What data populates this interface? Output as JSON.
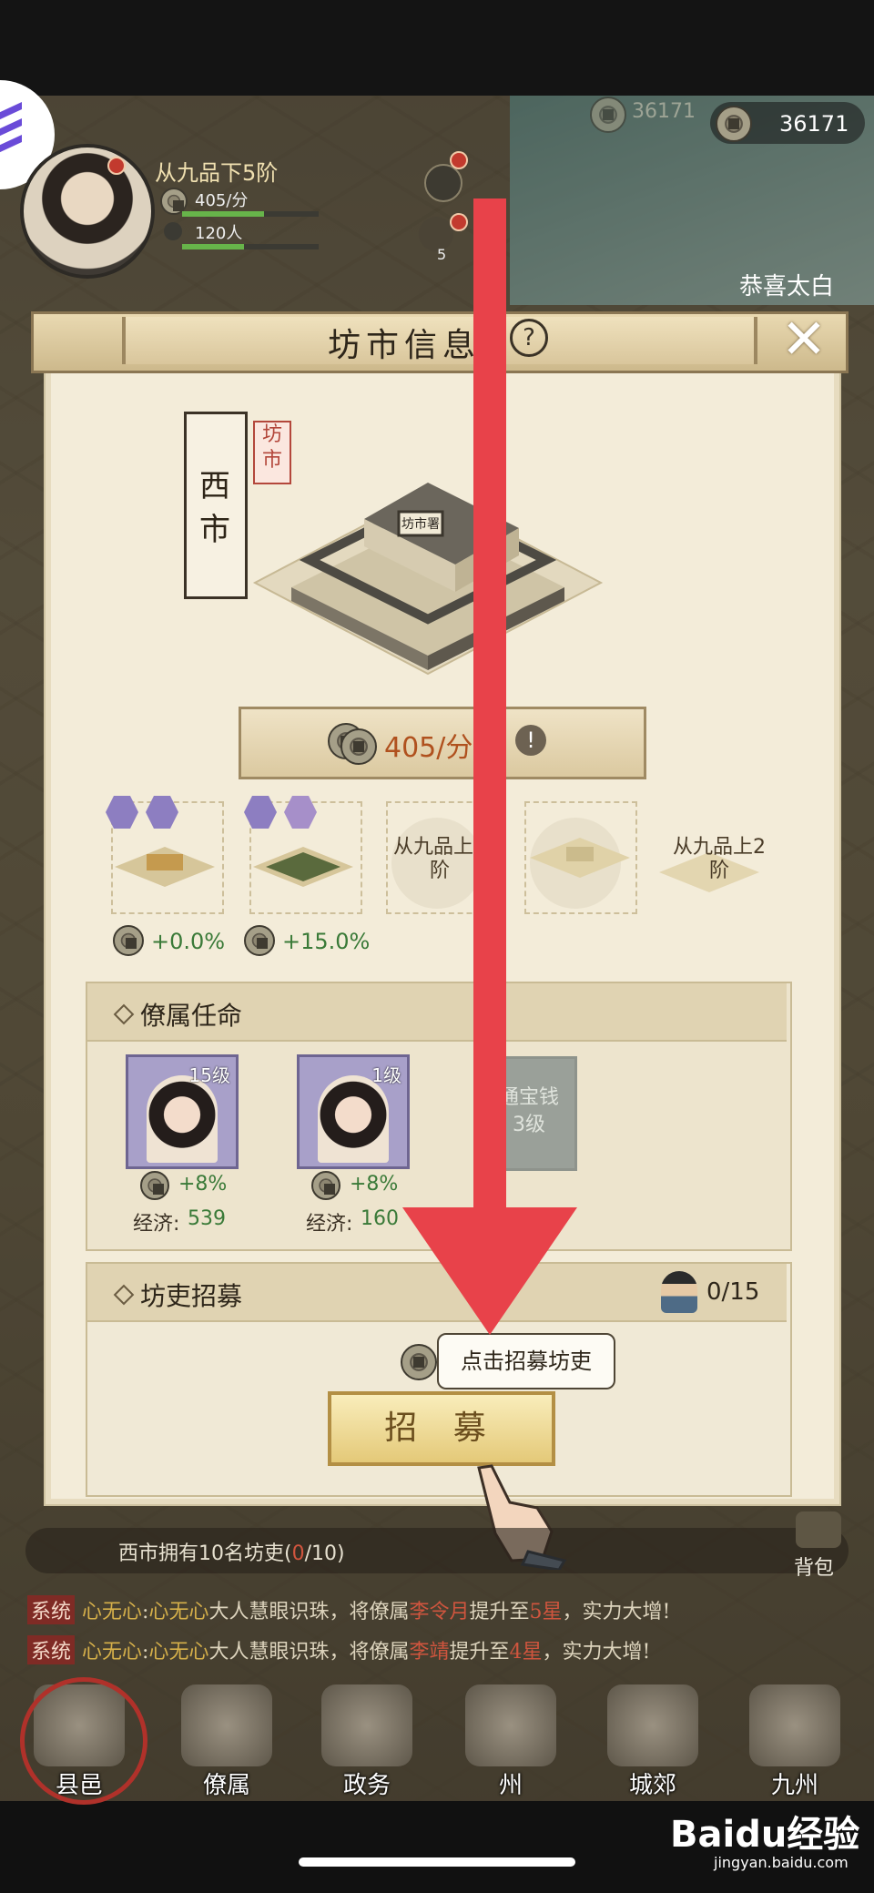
{
  "currency": {
    "ghost_value": "36171",
    "value": "36171"
  },
  "player": {
    "rank": "从九品下5阶",
    "income": "405/分",
    "population": "120人",
    "badge_count": "5"
  },
  "marquee": "恭喜太白",
  "modal": {
    "title": "坊市信息",
    "help": "?",
    "close": "✕",
    "market_name": "西市",
    "building_tag": "坊市",
    "building_plaque": "坊市署",
    "rate": "405/分钟",
    "rate_info": "!",
    "upgrades": [
      {
        "bonus": "+0.0%"
      },
      {
        "bonus": "+15.0%"
      },
      {
        "label": "从九品上2阶"
      },
      {
        "label": ""
      },
      {
        "label": "从九品上2阶"
      }
    ],
    "appointments": {
      "title": "僚属任命",
      "cards": [
        {
          "level": "15级",
          "bonus": "+8%",
          "economy_label": "经济:",
          "economy_value": "539"
        },
        {
          "level": "1级",
          "bonus": "+8%",
          "economy_label": "经济:",
          "economy_value": "160"
        }
      ],
      "locked_card": "通宝钱3级"
    },
    "recruit": {
      "title": "坊吏招募",
      "count": "0/15",
      "tooltip": "点击招募坊吏",
      "button": "招 募"
    }
  },
  "shop_status": {
    "prefix": "西市拥有10名坊吏(",
    "current": "0",
    "suffix": "/10)"
  },
  "backpack": "背包",
  "chat": [
    {
      "tag": "系统",
      "speaker": "心无心",
      "colon": ":",
      "who": "心无心",
      "mid": "大人慧眼识珠，将僚属",
      "subordinate": "李令月",
      "mid2": "提升至",
      "stars": "5星",
      "end": "，实力大增!"
    },
    {
      "tag": "系统",
      "speaker": "心无心",
      "colon": ":",
      "who": "心无心",
      "mid": "大人慧眼识珠，将僚属",
      "subordinate": "李靖",
      "mid2": "提升至",
      "stars": "4星",
      "end": "，实力大增!"
    }
  ],
  "nav": [
    {
      "label": "县邑"
    },
    {
      "label": "僚属"
    },
    {
      "label": "政务"
    },
    {
      "label": "州"
    },
    {
      "label": "城郊"
    },
    {
      "label": "九州"
    }
  ],
  "watermark": {
    "brand": "Baidu经验",
    "url": "jingyan.baidu.com"
  },
  "colors": {
    "accent_red": "#e8424a",
    "bonus_green": "#3a7a38",
    "rate_orange": "#b0511e"
  }
}
